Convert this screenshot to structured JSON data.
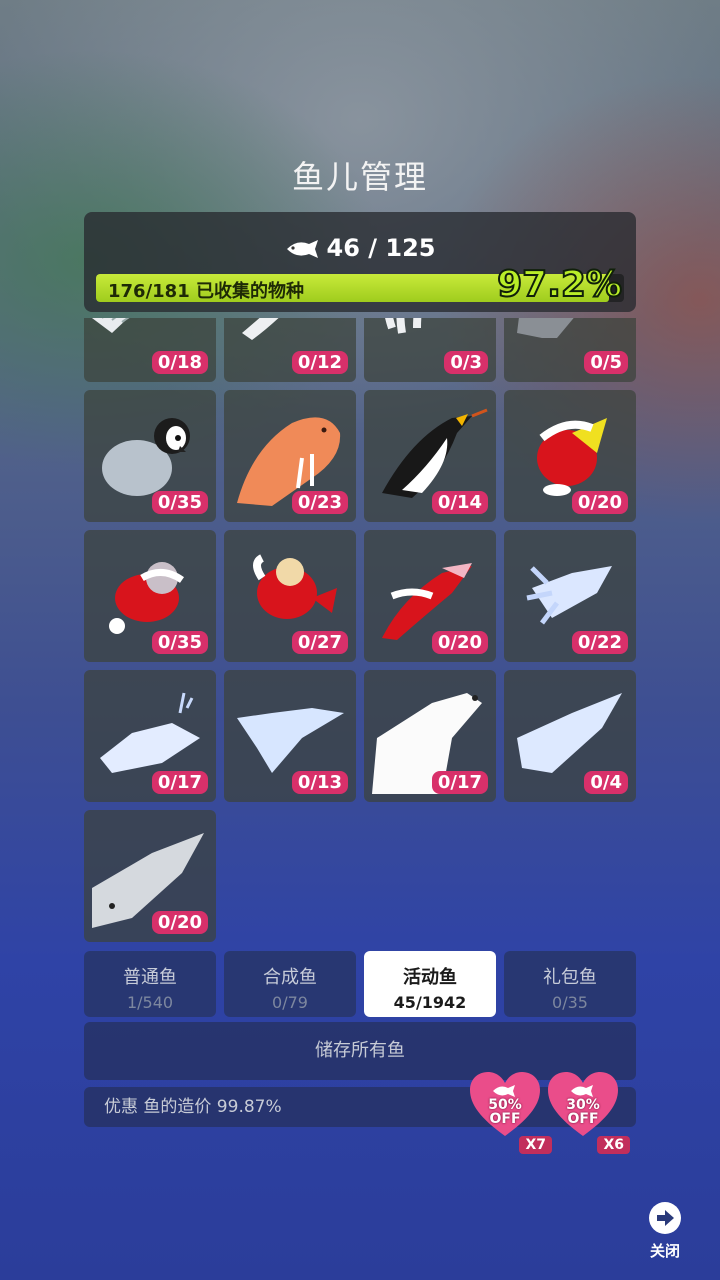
{
  "title": "鱼儿管理",
  "summary": {
    "fish_count": "46 / 125",
    "species_text": "176/181 已收集的物种",
    "percent_text": "97.2%",
    "percent_value": 0.972
  },
  "fish_cards": [
    {
      "icon": "skeleton-fish-icon",
      "count": "0/18"
    },
    {
      "icon": "skeleton-shrimp-icon",
      "count": "0/12"
    },
    {
      "icon": "skeleton-crab-icon",
      "count": "0/3"
    },
    {
      "icon": "gray-fish-icon",
      "count": "0/5"
    },
    {
      "icon": "baby-penguin-icon",
      "count": "0/35"
    },
    {
      "icon": "walrus-icon",
      "count": "0/23"
    },
    {
      "icon": "king-penguin-icon",
      "count": "0/14"
    },
    {
      "icon": "santa-chick-icon",
      "count": "0/20"
    },
    {
      "icon": "santa-fish-icon",
      "count": "0/35"
    },
    {
      "icon": "santa-goldfish-icon",
      "count": "0/27"
    },
    {
      "icon": "santa-dolphin-icon",
      "count": "0/20"
    },
    {
      "icon": "ice-fish-icon",
      "count": "0/22"
    },
    {
      "icon": "ice-whale-icon",
      "count": "0/17"
    },
    {
      "icon": "ice-dolphin-icon",
      "count": "0/13"
    },
    {
      "icon": "polar-bear-icon",
      "count": "0/17"
    },
    {
      "icon": "ice-shark-icon",
      "count": "0/4"
    },
    {
      "icon": "blue-whale-icon",
      "count": "0/20"
    }
  ],
  "tabs": [
    {
      "label": "普通鱼",
      "count": "1/540"
    },
    {
      "label": "合成鱼",
      "count": "0/79"
    },
    {
      "label": "活动鱼",
      "count": "45/1942"
    },
    {
      "label": "礼包鱼",
      "count": "0/35"
    }
  ],
  "active_tab": 2,
  "store_all_label": "储存所有鱼",
  "discount_text": "优惠 鱼的造价 99.87%",
  "coupons": [
    {
      "line1": "50%",
      "line2": "OFF",
      "multiplier": "X7"
    },
    {
      "line1": "30%",
      "line2": "OFF",
      "multiplier": "X6"
    }
  ],
  "close_label": "关闭",
  "colors": {
    "accent_pink": "#d8306a",
    "progress_green": "#b9ee28"
  }
}
